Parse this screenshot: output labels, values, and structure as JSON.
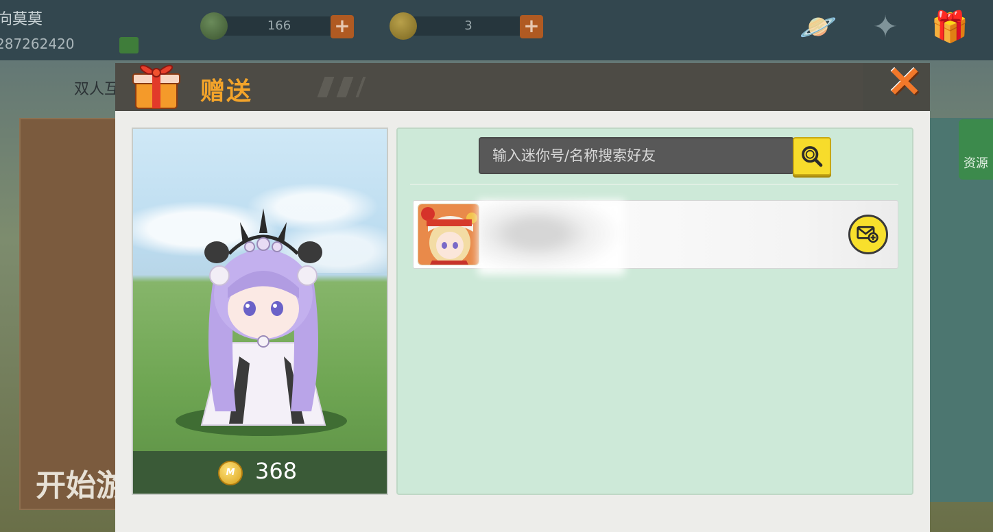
{
  "background": {
    "player_name": "向莫莫",
    "player_id": "287262420",
    "gem_count": "166",
    "coin_count": "3",
    "tab_text": "双人互",
    "start_text": "开始游",
    "right_tag": "资源",
    "icons": [
      "planet-icon",
      "star-icon",
      "gift-box-icon"
    ]
  },
  "dialog": {
    "title": "赠送",
    "close_label": "×"
  },
  "preview": {
    "price": "368",
    "coin_label": "M"
  },
  "friends": {
    "search_placeholder": "输入迷你号/名称搜索好友",
    "list": [
      {
        "avatar": "anime-girl-avatar",
        "name_blurred": true
      }
    ]
  },
  "colors": {
    "title_orange": "#f4a42a",
    "close_orange": "#f2782a",
    "panel_green": "#cde9d8",
    "search_yellow": "#f7dc2b"
  }
}
